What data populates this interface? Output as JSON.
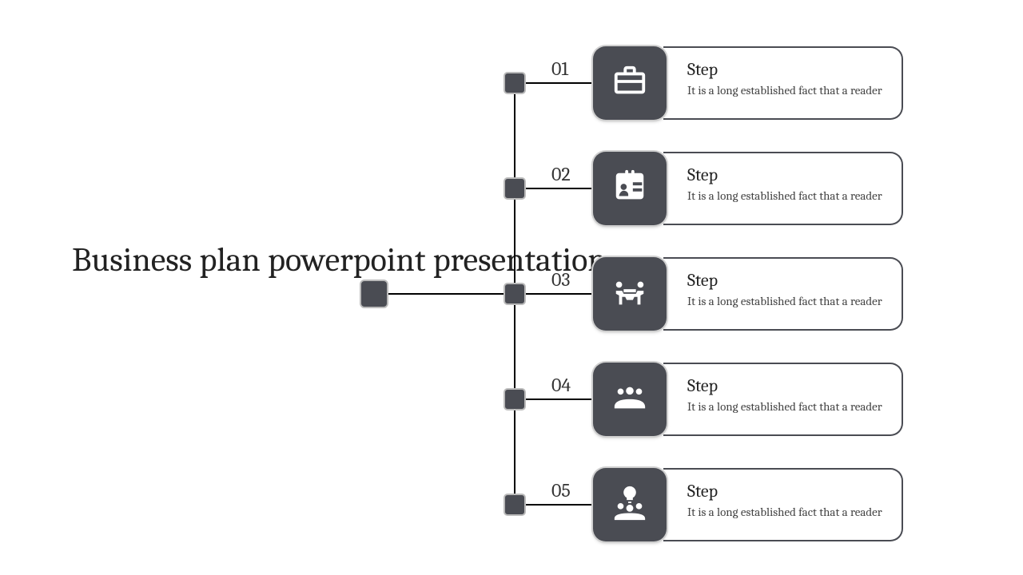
{
  "title": "Business plan powerpoint presentation",
  "steps": [
    {
      "num": "01",
      "title": "Step",
      "desc": "It is a long established fact that a reader",
      "icon": "briefcase"
    },
    {
      "num": "02",
      "title": "Step",
      "desc": "It is a long established fact that a reader",
      "icon": "badge"
    },
    {
      "num": "03",
      "title": "Step",
      "desc": "It is a long established fact that a reader",
      "icon": "meeting"
    },
    {
      "num": "04",
      "title": "Step",
      "desc": "It is a long established fact that a reader",
      "icon": "group"
    },
    {
      "num": "05",
      "title": "Step",
      "desc": "It is a long established fact that a reader",
      "icon": "idea-group"
    }
  ],
  "colors": {
    "dark": "#4a4c53"
  }
}
